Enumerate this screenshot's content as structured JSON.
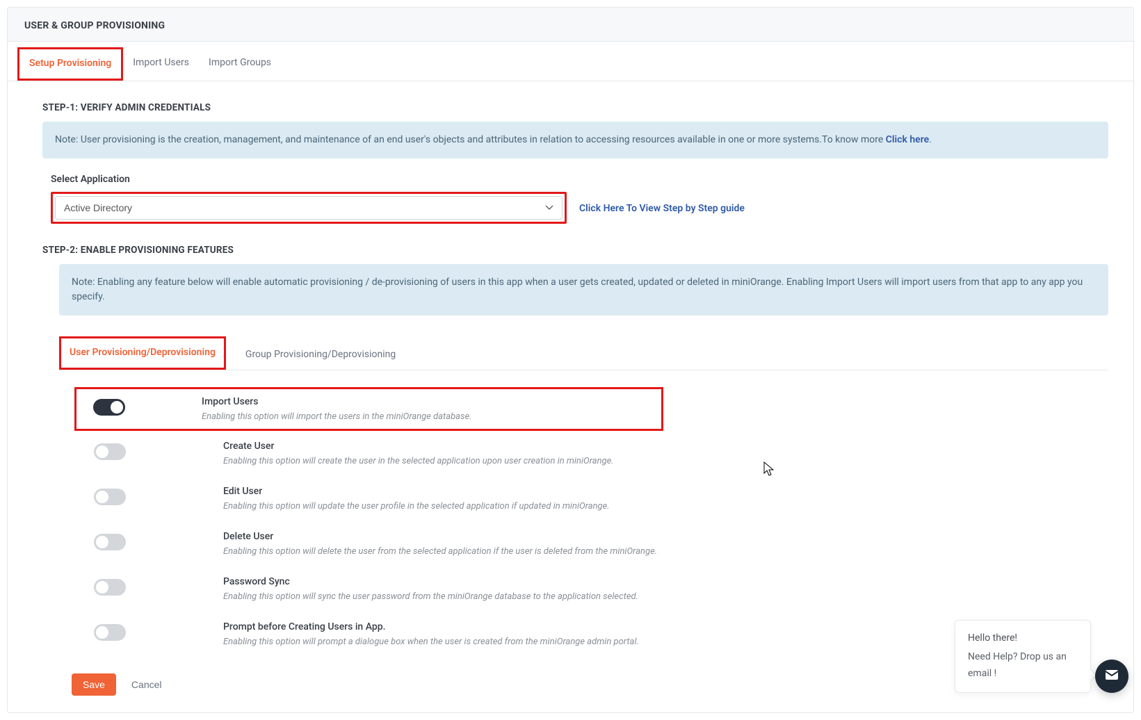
{
  "header": {
    "title": "USER & GROUP PROVISIONING"
  },
  "tabs": {
    "setup": "Setup Provisioning",
    "import_users": "Import Users",
    "import_groups": "Import Groups"
  },
  "step1": {
    "title": "STEP-1: VERIFY ADMIN CREDENTIALS",
    "note_prefix": "Note: User provisioning is the creation, management, and maintenance of an end user's objects and attributes in relation to accessing resources available in one or more systems.To know more ",
    "note_link": "Click here",
    "note_suffix": ".",
    "select_label": "Select Application",
    "select_value": "Active Directory",
    "guide_link": "Click Here To View Step by Step guide"
  },
  "step2": {
    "title": "STEP-2: ENABLE PROVISIONING FEATURES",
    "note": "Note: Enabling any feature below will enable automatic provisioning / de-provisioning of users in this app when a user gets created, updated or deleted in miniOrange. Enabling Import Users will import users from that app to any app you specify.",
    "inner_tabs": {
      "user": "User Provisioning/Deprovisioning",
      "group": "Group Provisioning/Deprovisioning"
    },
    "features": [
      {
        "title": "Import Users",
        "desc": "Enabling this option will import the users in the miniOrange database.",
        "on": true
      },
      {
        "title": "Create User",
        "desc": "Enabling this option will create the user in the selected application upon user creation in miniOrange.",
        "on": false
      },
      {
        "title": "Edit User",
        "desc": "Enabling this option will update the user profile in the selected application if updated in miniOrange.",
        "on": false
      },
      {
        "title": "Delete User",
        "desc": "Enabling this option will delete the user from the selected application if the user is deleted from the miniOrange.",
        "on": false
      },
      {
        "title": "Password Sync",
        "desc": "Enabling this option will sync the user password from the miniOrange database to the application selected.",
        "on": false
      },
      {
        "title": "Prompt before Creating Users in App.",
        "desc": "Enabling this option will prompt a dialogue box when the user is created from the miniOrange admin portal.",
        "on": false
      }
    ]
  },
  "actions": {
    "save": "Save",
    "cancel": "Cancel"
  },
  "help": {
    "greeting": "Hello there!",
    "text": "Need Help? Drop us an email !"
  }
}
